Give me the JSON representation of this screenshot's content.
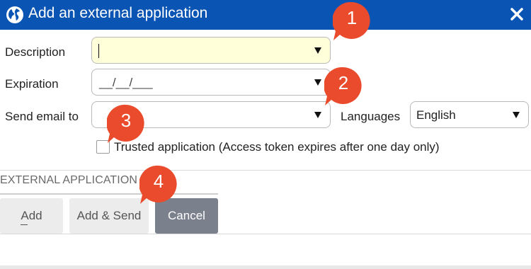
{
  "dialog": {
    "title": "Add an external application",
    "icon": "globe-icon",
    "close_icon": "close-icon",
    "header_color": "#0a54b4"
  },
  "form": {
    "description": {
      "label": "Description",
      "value": "",
      "field_color": "#ffffd9"
    },
    "expiration": {
      "label": "Expiration",
      "placeholder": "__/__/___"
    },
    "send_email": {
      "label": "Send email to",
      "value": ""
    },
    "languages": {
      "label": "Languages",
      "value": "English"
    },
    "trusted": {
      "label": "Trusted application (Access token expires after one day only)",
      "checked": false
    }
  },
  "section": {
    "title": "EXTERNAL APPLICATION"
  },
  "buttons": {
    "add": "Add",
    "add_send": "Add & Send",
    "cancel": "Cancel"
  },
  "callouts": [
    {
      "number": "1",
      "color": "#ea4b2c"
    },
    {
      "number": "2",
      "color": "#ea4b2c"
    },
    {
      "number": "3",
      "color": "#ea4b2c"
    },
    {
      "number": "4",
      "color": "#ea4b2c"
    }
  ]
}
